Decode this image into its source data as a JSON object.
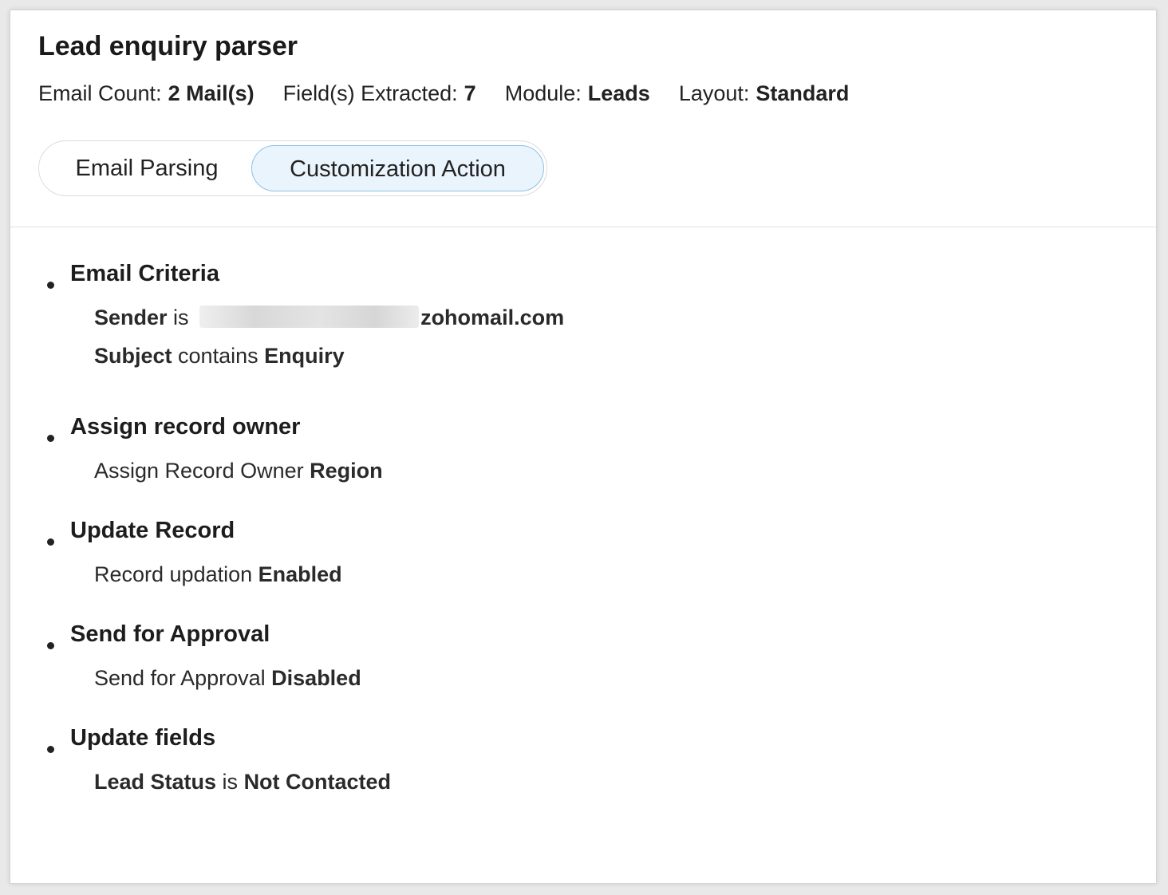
{
  "title": "Lead enquiry parser",
  "meta": [
    {
      "label": "Email Count:",
      "value": "2 Mail(s)"
    },
    {
      "label": "Field(s) Extracted:",
      "value": "7"
    },
    {
      "label": "Module:",
      "value": "Leads"
    },
    {
      "label": "Layout:",
      "value": "Standard"
    }
  ],
  "tabs": [
    {
      "label": "Email Parsing",
      "active": false
    },
    {
      "label": "Customization Action",
      "active": true
    }
  ],
  "sections": {
    "email_criteria": {
      "title": "Email Criteria",
      "sender_field": "Sender",
      "sender_op": " is ",
      "sender_value_suffix": "zohomail.com",
      "subject_field": "Subject",
      "subject_op": " contains ",
      "subject_value": "Enquiry"
    },
    "assign_owner": {
      "title": "Assign record owner",
      "text": "Assign Record Owner ",
      "value": "Region"
    },
    "update_record": {
      "title": "Update Record",
      "text": "Record updation ",
      "value": "Enabled"
    },
    "send_approval": {
      "title": "Send for Approval",
      "text": "Send for Approval ",
      "value": "Disabled"
    },
    "update_fields": {
      "title": "Update fields",
      "field": "Lead Status",
      "op": " is ",
      "value": "Not Contacted"
    }
  },
  "colors": {
    "active_tab_bg": "#eaf4fc",
    "active_tab_border": "#8ec2e6"
  }
}
